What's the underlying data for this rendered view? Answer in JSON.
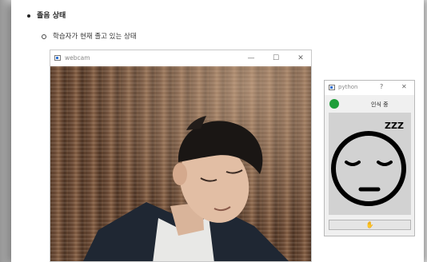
{
  "doc": {
    "heading": "졸음 상태",
    "subitem": "학습자가 현재 졸고 있는 상태"
  },
  "webcam_window": {
    "title": "webcam",
    "minimize": "—",
    "maximize": "☐",
    "close": "✕"
  },
  "python_window": {
    "title": "python",
    "help": "?",
    "close": "✕",
    "status_text": "인식 중",
    "status_color": "#1e9e3a",
    "sleep_text": "ZZZ",
    "button_icon": "hand-icon"
  }
}
